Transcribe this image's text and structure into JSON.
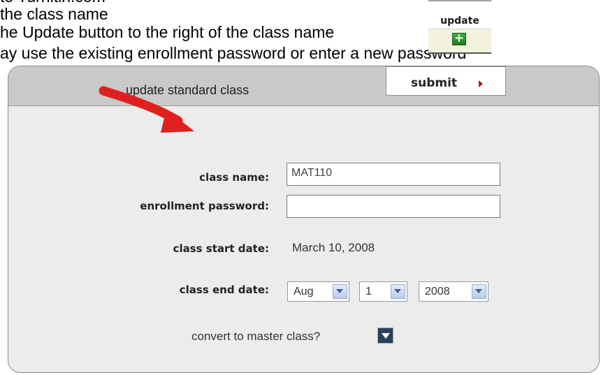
{
  "instructions": {
    "line1": "to Turnitin.com",
    "line2": "the class name",
    "line3": "he Update button to the right of the class name",
    "line4": "ay use the existing enrollment password or enter a new password"
  },
  "update_widget": {
    "label": "update",
    "button_icon": "plus-icon"
  },
  "form": {
    "title": "update standard class",
    "submit_label": "submit",
    "class_name_label": "class name:",
    "class_name_value": "MAT110",
    "enrollment_password_label": "enrollment password:",
    "enrollment_password_value": "",
    "class_start_label": "class start date:",
    "class_start_value": "March 10, 2008",
    "class_end_label": "class end date:",
    "end_month": "Aug",
    "end_day": "1",
    "end_year": "2008",
    "convert_label": "convert to master class?"
  },
  "colors": {
    "annotation_arrow": "#e02020",
    "submit_arrow": "#9b1c1c",
    "header_bg": "#c9c9c9",
    "panel_bg": "#ececec"
  }
}
